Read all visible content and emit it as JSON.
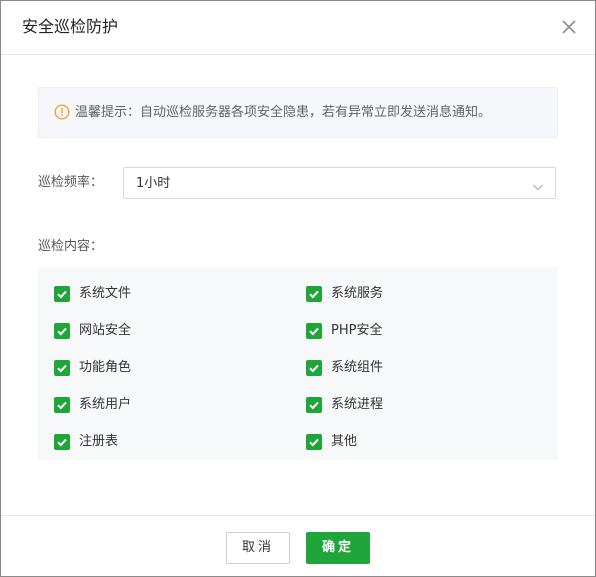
{
  "dialog": {
    "title": "安全巡检防护",
    "close_icon": "close-icon"
  },
  "alert": {
    "icon": "warning-circle-icon",
    "text": "温馨提示：自动巡检服务器各项安全隐患，若有异常立即发送消息通知。"
  },
  "frequency": {
    "label": "巡检频率：",
    "selected": "1小时"
  },
  "content": {
    "label": "巡检内容：",
    "items": [
      {
        "label": "系统文件",
        "checked": true
      },
      {
        "label": "系统服务",
        "checked": true
      },
      {
        "label": "网站安全",
        "checked": true
      },
      {
        "label": "PHP安全",
        "checked": true
      },
      {
        "label": "功能角色",
        "checked": true
      },
      {
        "label": "系统组件",
        "checked": true
      },
      {
        "label": "系统用户",
        "checked": true
      },
      {
        "label": "系统进程",
        "checked": true
      },
      {
        "label": "注册表",
        "checked": true
      },
      {
        "label": "其他",
        "checked": true
      }
    ]
  },
  "footer": {
    "cancel_label": "取消",
    "confirm_label": "确定"
  },
  "colors": {
    "accent": "#20a53a",
    "warning": "#f0a23c"
  }
}
